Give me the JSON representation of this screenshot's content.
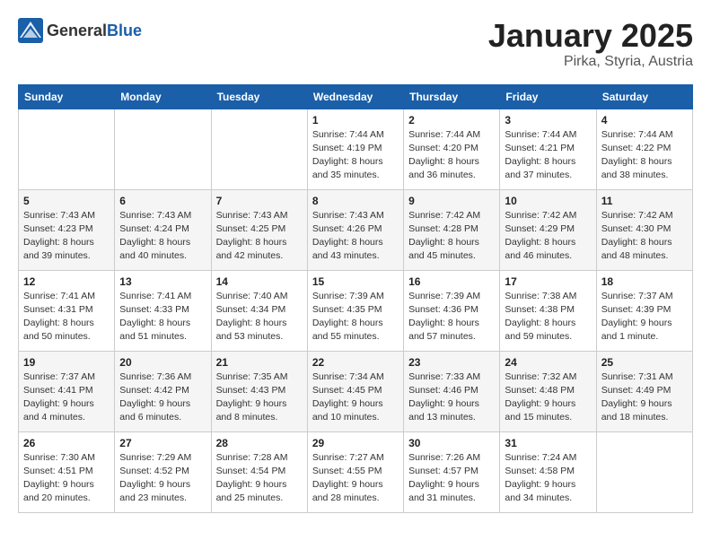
{
  "header": {
    "logo_general": "General",
    "logo_blue": "Blue",
    "month": "January 2025",
    "location": "Pirka, Styria, Austria"
  },
  "weekdays": [
    "Sunday",
    "Monday",
    "Tuesday",
    "Wednesday",
    "Thursday",
    "Friday",
    "Saturday"
  ],
  "weeks": [
    [
      {
        "day": "",
        "info": ""
      },
      {
        "day": "",
        "info": ""
      },
      {
        "day": "",
        "info": ""
      },
      {
        "day": "1",
        "info": "Sunrise: 7:44 AM\nSunset: 4:19 PM\nDaylight: 8 hours and 35 minutes."
      },
      {
        "day": "2",
        "info": "Sunrise: 7:44 AM\nSunset: 4:20 PM\nDaylight: 8 hours and 36 minutes."
      },
      {
        "day": "3",
        "info": "Sunrise: 7:44 AM\nSunset: 4:21 PM\nDaylight: 8 hours and 37 minutes."
      },
      {
        "day": "4",
        "info": "Sunrise: 7:44 AM\nSunset: 4:22 PM\nDaylight: 8 hours and 38 minutes."
      }
    ],
    [
      {
        "day": "5",
        "info": "Sunrise: 7:43 AM\nSunset: 4:23 PM\nDaylight: 8 hours and 39 minutes."
      },
      {
        "day": "6",
        "info": "Sunrise: 7:43 AM\nSunset: 4:24 PM\nDaylight: 8 hours and 40 minutes."
      },
      {
        "day": "7",
        "info": "Sunrise: 7:43 AM\nSunset: 4:25 PM\nDaylight: 8 hours and 42 minutes."
      },
      {
        "day": "8",
        "info": "Sunrise: 7:43 AM\nSunset: 4:26 PM\nDaylight: 8 hours and 43 minutes."
      },
      {
        "day": "9",
        "info": "Sunrise: 7:42 AM\nSunset: 4:28 PM\nDaylight: 8 hours and 45 minutes."
      },
      {
        "day": "10",
        "info": "Sunrise: 7:42 AM\nSunset: 4:29 PM\nDaylight: 8 hours and 46 minutes."
      },
      {
        "day": "11",
        "info": "Sunrise: 7:42 AM\nSunset: 4:30 PM\nDaylight: 8 hours and 48 minutes."
      }
    ],
    [
      {
        "day": "12",
        "info": "Sunrise: 7:41 AM\nSunset: 4:31 PM\nDaylight: 8 hours and 50 minutes."
      },
      {
        "day": "13",
        "info": "Sunrise: 7:41 AM\nSunset: 4:33 PM\nDaylight: 8 hours and 51 minutes."
      },
      {
        "day": "14",
        "info": "Sunrise: 7:40 AM\nSunset: 4:34 PM\nDaylight: 8 hours and 53 minutes."
      },
      {
        "day": "15",
        "info": "Sunrise: 7:39 AM\nSunset: 4:35 PM\nDaylight: 8 hours and 55 minutes."
      },
      {
        "day": "16",
        "info": "Sunrise: 7:39 AM\nSunset: 4:36 PM\nDaylight: 8 hours and 57 minutes."
      },
      {
        "day": "17",
        "info": "Sunrise: 7:38 AM\nSunset: 4:38 PM\nDaylight: 8 hours and 59 minutes."
      },
      {
        "day": "18",
        "info": "Sunrise: 7:37 AM\nSunset: 4:39 PM\nDaylight: 9 hours and 1 minute."
      }
    ],
    [
      {
        "day": "19",
        "info": "Sunrise: 7:37 AM\nSunset: 4:41 PM\nDaylight: 9 hours and 4 minutes."
      },
      {
        "day": "20",
        "info": "Sunrise: 7:36 AM\nSunset: 4:42 PM\nDaylight: 9 hours and 6 minutes."
      },
      {
        "day": "21",
        "info": "Sunrise: 7:35 AM\nSunset: 4:43 PM\nDaylight: 9 hours and 8 minutes."
      },
      {
        "day": "22",
        "info": "Sunrise: 7:34 AM\nSunset: 4:45 PM\nDaylight: 9 hours and 10 minutes."
      },
      {
        "day": "23",
        "info": "Sunrise: 7:33 AM\nSunset: 4:46 PM\nDaylight: 9 hours and 13 minutes."
      },
      {
        "day": "24",
        "info": "Sunrise: 7:32 AM\nSunset: 4:48 PM\nDaylight: 9 hours and 15 minutes."
      },
      {
        "day": "25",
        "info": "Sunrise: 7:31 AM\nSunset: 4:49 PM\nDaylight: 9 hours and 18 minutes."
      }
    ],
    [
      {
        "day": "26",
        "info": "Sunrise: 7:30 AM\nSunset: 4:51 PM\nDaylight: 9 hours and 20 minutes."
      },
      {
        "day": "27",
        "info": "Sunrise: 7:29 AM\nSunset: 4:52 PM\nDaylight: 9 hours and 23 minutes."
      },
      {
        "day": "28",
        "info": "Sunrise: 7:28 AM\nSunset: 4:54 PM\nDaylight: 9 hours and 25 minutes."
      },
      {
        "day": "29",
        "info": "Sunrise: 7:27 AM\nSunset: 4:55 PM\nDaylight: 9 hours and 28 minutes."
      },
      {
        "day": "30",
        "info": "Sunrise: 7:26 AM\nSunset: 4:57 PM\nDaylight: 9 hours and 31 minutes."
      },
      {
        "day": "31",
        "info": "Sunrise: 7:24 AM\nSunset: 4:58 PM\nDaylight: 9 hours and 34 minutes."
      },
      {
        "day": "",
        "info": ""
      }
    ]
  ]
}
